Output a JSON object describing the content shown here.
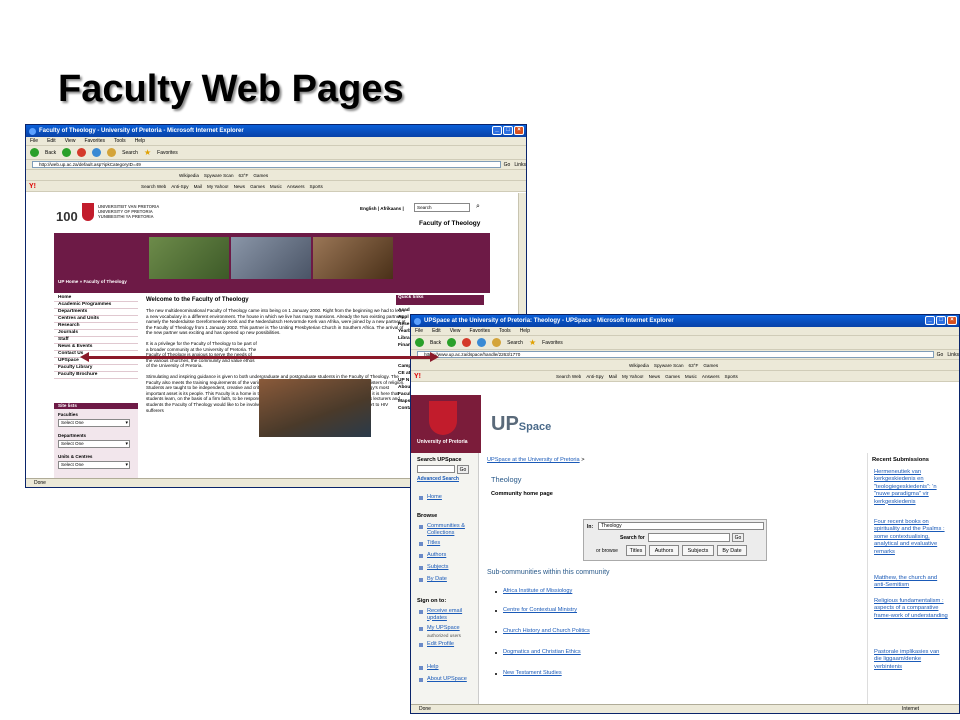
{
  "slide": {
    "title": "Faculty Web Pages"
  },
  "colors": {
    "maroon": "#6d1a46",
    "arrow": "#8b1a2a",
    "link": "#1a5ab8",
    "xp_blue": "#0842a8"
  },
  "window1": {
    "title": "Faculty of Theology - University of Pretoria - Microsoft Internet Explorer",
    "menu": [
      "File",
      "Edit",
      "View",
      "Favorites",
      "Tools",
      "Help"
    ],
    "toolbar": {
      "back": "Back",
      "search": "Search",
      "favorites": "Favorites"
    },
    "address": "http://web.up.ac.za/default.asp?ipkCategoryID=49",
    "go": "Go",
    "links": "Links",
    "ybar": [
      "Y!",
      "Search Web",
      "Anti-Spy",
      "Mail",
      "My Yahoo!",
      "News",
      "Games",
      "Music",
      "Answers",
      "Sports"
    ],
    "vmn_bar": [
      "Wikipedia",
      "Spyware Scan",
      "63°F",
      "Games"
    ],
    "page": {
      "logo_100": "100",
      "uni_names": [
        "UNIVERSITEIT VAN PRETORIA",
        "UNIVERSITY OF PRETORIA",
        "YUNIBESITHI YA PRETORIA"
      ],
      "lang": "English | Afrikaans |",
      "search_value": "Search",
      "faculty_title": "Faculty of Theology",
      "crumb": "UP Home » Faculty of Theology",
      "nav": [
        "Home",
        "Academic Programmes",
        "Departments",
        "Centres and Units",
        "Research",
        "Journals",
        "Staff",
        "News & Events",
        "Contact Us",
        "UPSpace",
        "Faculty Library",
        "Faculty Brochure"
      ],
      "site_lists": {
        "header": "Site lists",
        "faculties_label": "Faculties",
        "departments_label": "Departments",
        "units_label": "Units & Centres",
        "select_one": "Select One"
      },
      "welcome": "Welcome to the Faculty of Theology",
      "body_para1": "The new multidenominational Faculty of Theology came into being on 1 January 2000. Right from the beginning we had to learn a new vocabulary in a different environment. The house in which we live has many mansions. Already the two existing partners, namely the Nederduitse Gereformeerde Kerk and the Nederduitsch Hervormde Kerk van Afrika, were joined by a new partner at the Faculty of Theology from 1 January 2002. This partner is The Uniting Presbyterian Church in Southern Africa. The arrival of the new partner was exciting and has opened up new possibilities.",
      "body_para2": "It is a privilege for the Faculty of Theology to be part of a broader community at the University of Pretoria. The Faculty of Theology is anxious to serve the needs of the various churches, the community and value ethos of the University of Pretoria.",
      "body_para3": "Stimulating and inspiring guidance is given to both undergraduate and postgraduate students in the Faculty of Theology. The Faculty also meets the training requirements of the various churches. Our goal is to educate well-equipped ministers of religion. Students are taught to be independent, creative and critical in their thinking and actions. The Faculty of Theology's most important asset is its people. This Faculty is a home in the true sense of the word to lecturers and students and it is here that students learn, on the basis of a firm faith, to be responsible and well-balanced members of society. Through its lecturers and students the Faculty of Theology would like to be involved in projects that serve society at large, such as support to HIV sufferers",
      "quick_links": "Quick links",
      "quick_items": [
        "Acad",
        "Appl",
        "Rese",
        "Yearb",
        "Libra",
        "Finan",
        "Camp",
        "CE at",
        "UP N",
        "Abou",
        "Facul",
        "Maps",
        "Conta"
      ]
    },
    "status": "Done"
  },
  "window2": {
    "title": "UPSpace at the University of Pretoria: Theology - UPSpace - Microsoft Internet Explorer",
    "menu": [
      "File",
      "Edit",
      "View",
      "Favorites",
      "Tools",
      "Help"
    ],
    "toolbar": {
      "back": "Back",
      "search": "Search",
      "favorites": "Favorites"
    },
    "address": "https://www.up.ac.za/dspace/handle/2263/1770",
    "go": "Go",
    "links": "Links",
    "ybar": [
      "Y!",
      "Search Web",
      "Anti-Spy",
      "Mail",
      "My Yahoo!",
      "News",
      "Games",
      "Music",
      "Answers",
      "Sports"
    ],
    "vmn_bar": [
      "Wikipedia",
      "Spyware Scan",
      "63°F",
      "Games"
    ],
    "page": {
      "uni_label": "University of Pretoria",
      "logo_up": "UP",
      "logo_space": "Space",
      "search_heading": "Search UPSpace",
      "go": "Go",
      "advanced": "Advanced Search",
      "home": "Home",
      "browse_heading": "Browse",
      "browse_items": [
        "Communities & Collections",
        "Titles",
        "Authors",
        "Subjects",
        "By Date"
      ],
      "signon_heading": "Sign on to:",
      "signon_items": [
        "Receive email updates",
        "My UPSpace",
        "Edit Profile"
      ],
      "authorized": "authorized users",
      "help": "Help",
      "about": "About UPSpace",
      "crumb_link": "UPSpace at the University of Pretoria",
      "crumb_sep": ">",
      "community": "Theology",
      "chp": "Community home page",
      "form": {
        "in_label": "In:",
        "in_value": "Theology",
        "search_for": "Search for",
        "go": "Go",
        "or_browse": "or browse",
        "buttons": [
          "Titles",
          "Authors",
          "Subjects",
          "By Date"
        ]
      },
      "subcomm_heading": "Sub-communities within this community",
      "subcomms": [
        "Africa Institute of Missiology",
        "Centre for Contextual Ministry",
        "Church History and Church Politics",
        "Dogmatics and Christian Ethics",
        "New Testament Studies"
      ],
      "recent_heading": "Recent Submissions",
      "recent": [
        "Hermeneutiek van kerkgeskiedenis en \"teologiegeskiedenis\": 'n \"nuwe paradigma\" vir kerkgeskiedenis",
        "Four recent books on spirituality and the Psalms : some contextualising, analytical and evaluative remarks",
        "Matthew, the church and anti-Semitism",
        "Religious fundamentalism : aspects of a comparative frame-work of understanding",
        "Pastorale implikasies van die liggaam/denke verbintenis"
      ]
    },
    "status": "Done",
    "zone": "Internet"
  }
}
